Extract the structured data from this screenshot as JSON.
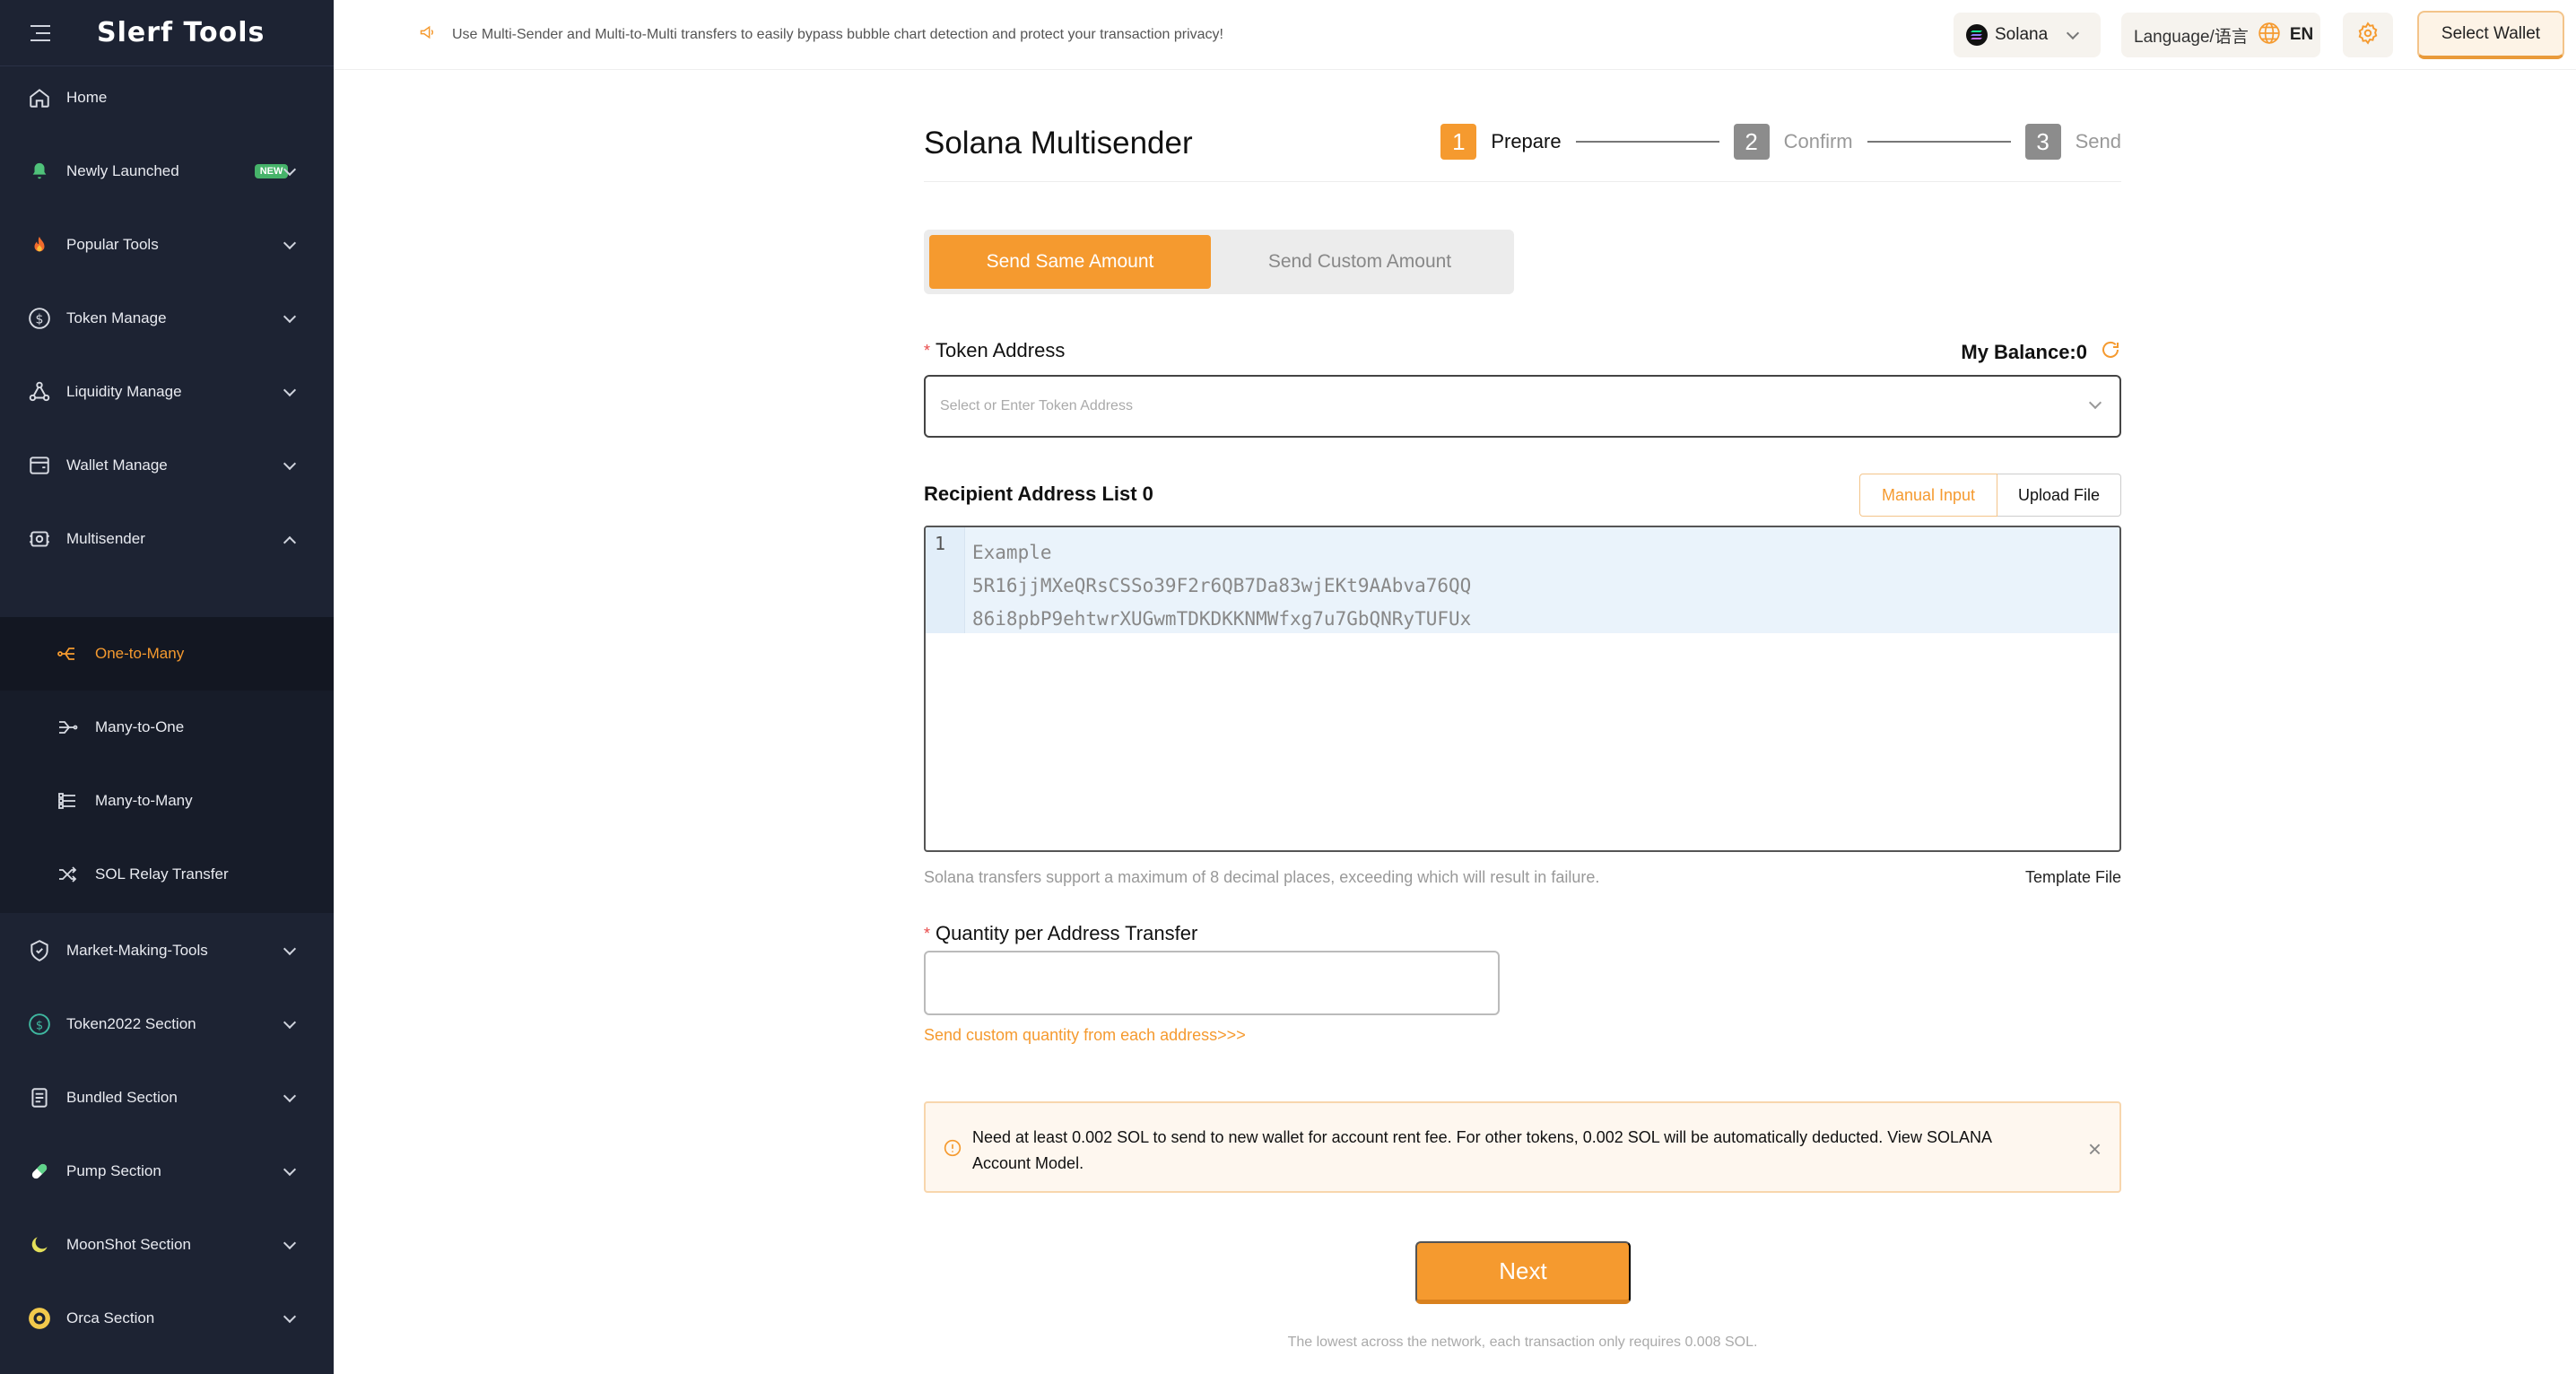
{
  "app": {
    "logo": "Slerf Tools"
  },
  "topbar": {
    "notice": "Use Multi-Sender and Multi-to-Multi transfers to easily bypass bubble chart detection and protect your transaction privacy!",
    "network": "Solana",
    "language_label": "Language/语言",
    "language_code": "EN",
    "wallet_button": "Select Wallet"
  },
  "sidebar": {
    "items": [
      {
        "label": "Home",
        "icon": "home-icon"
      },
      {
        "label": "Newly Launched",
        "icon": "bell-icon",
        "badge": "NEW"
      },
      {
        "label": "Popular Tools",
        "icon": "fire-icon"
      },
      {
        "label": "Token Manage",
        "icon": "dollar-icon"
      },
      {
        "label": "Liquidity Manage",
        "icon": "nodes-icon"
      },
      {
        "label": "Wallet Manage",
        "icon": "wallet-icon"
      },
      {
        "label": "Multisender",
        "icon": "multisender-icon"
      },
      {
        "label": "Market-Making-Tools",
        "icon": "shield-icon"
      },
      {
        "label": "Token2022 Section",
        "icon": "token2022-icon"
      },
      {
        "label": "Bundled Section",
        "icon": "bundle-icon"
      },
      {
        "label": "Pump Section",
        "icon": "pill-icon"
      },
      {
        "label": "MoonShot Section",
        "icon": "moon-icon"
      },
      {
        "label": "Orca Section",
        "icon": "orca-icon"
      }
    ],
    "submenu": [
      {
        "label": "One-to-Many",
        "active": true
      },
      {
        "label": "Many-to-One",
        "active": false
      },
      {
        "label": "Many-to-Many",
        "active": false
      },
      {
        "label": "SOL Relay Transfer",
        "active": false
      }
    ]
  },
  "main": {
    "title": "Solana Multisender",
    "steps": [
      {
        "num": "1",
        "label": "Prepare",
        "active": true
      },
      {
        "num": "2",
        "label": "Confirm",
        "active": false
      },
      {
        "num": "3",
        "label": "Send",
        "active": false
      }
    ],
    "toggle": {
      "same": "Send Same Amount",
      "custom": "Send Custom Amount"
    },
    "token_label": "Token Address",
    "balance": "My Balance:0",
    "token_placeholder": "Select or Enter Token Address",
    "list_label": "Recipient Address List 0",
    "manual_input": "Manual Input",
    "upload_file": "Upload File",
    "editor": {
      "line_number": "1",
      "line1": "Example",
      "line2": "5R16jjMXeQRsCSSo39F2r6QB7Da83wjEKt9AAbva76QQ",
      "line3": "86i8pbP9ehtwrXUGwmTDKDKKNMWfxg7u7GbQNRyTUFUx"
    },
    "hint": "Solana transfers support a maximum of 8 decimal places, exceeding which will result in failure.",
    "template_file": "Template File",
    "quantity_label": "Quantity per Address Transfer",
    "quantity_value": "",
    "custom_link": "Send custom quantity from each address>>>",
    "alert": "Need at least 0.002 SOL to send to new wallet for account rent fee. For other tokens, 0.002 SOL will be automatically deducted. View SOLANA Account Model.",
    "next": "Next",
    "footnote": "The lowest across the network, each transaction only requires 0.008 SOL."
  },
  "colors": {
    "accent": "#f59a2f",
    "sidebar_bg": "#1d2333",
    "required": "#e84a4a"
  }
}
